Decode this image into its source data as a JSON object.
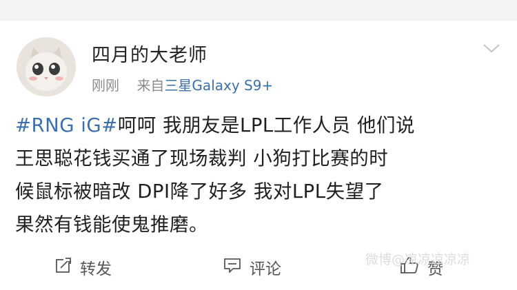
{
  "post": {
    "username": "四月的大老师",
    "time": "刚刚",
    "source_prefix": "来自",
    "device": "三星Galaxy S9+",
    "hashtag": "#RNG iG#",
    "line1_rest": "呵呵 我朋友是LPL工作人员 他们说",
    "line2": "王思聪花钱买通了现场裁判  小狗打比赛的时",
    "line3": "候鼠标被暗改  DPI降了好多 我对LPL失望了",
    "line4": "果然有钱能使鬼推磨。"
  },
  "actions": {
    "repost_label": "转发",
    "comment_label": "评论",
    "like_label": "赞"
  },
  "watermark": {
    "text": "微博@凉凉凉凉凉"
  },
  "icons": {
    "menu": "chevron-down-icon",
    "repost": "repost-icon",
    "comment": "comment-icon",
    "like": "thumbs-up-icon"
  },
  "colors": {
    "background": "#f3f3f3",
    "card": "#ffffff",
    "link": "#3d6fa8",
    "meta": "#8b8b8b"
  }
}
